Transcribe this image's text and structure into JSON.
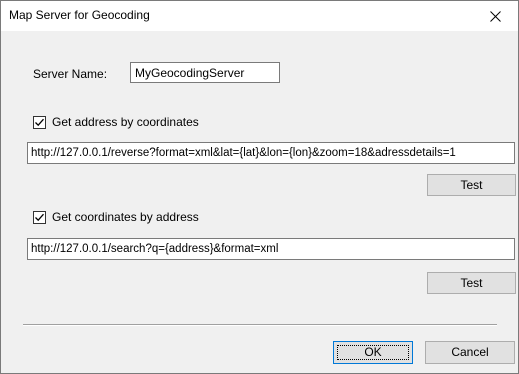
{
  "window": {
    "title": "Map Server for Geocoding",
    "close_glyph": "close-icon"
  },
  "server": {
    "label": "Server Name:",
    "value": "MyGeocodingServer"
  },
  "reverse": {
    "checkbox_label": "Get address by coordinates",
    "checked": true,
    "url": "http://127.0.0.1/reverse?format=xml&lat={lat}&lon={lon}&zoom=18&adressdetails=1",
    "test_label": "Test"
  },
  "search": {
    "checkbox_label": "Get coordinates by address",
    "checked": true,
    "url": "http://127.0.0.1/search?q={address}&format=xml",
    "test_label": "Test"
  },
  "footer": {
    "ok_label": "OK",
    "cancel_label": "Cancel"
  },
  "colors": {
    "dialog_background": "#f0f0f0",
    "titlebar_background": "#ffffff",
    "button_face": "#e1e1e1",
    "default_button_border": "#0078d7"
  }
}
